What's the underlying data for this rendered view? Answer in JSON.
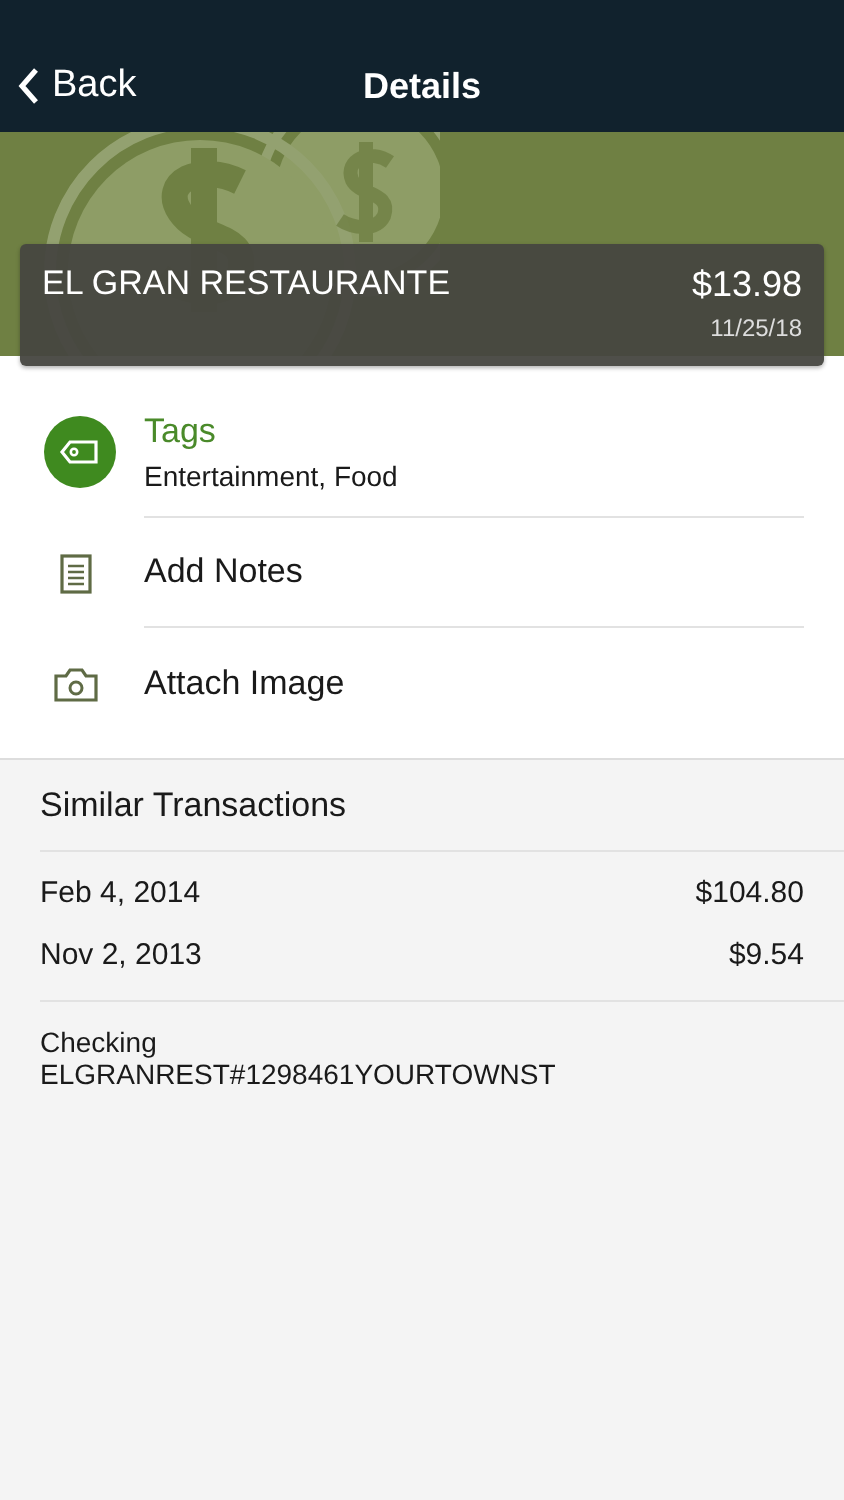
{
  "nav": {
    "back": "Back",
    "title": "Details"
  },
  "transaction": {
    "merchant": "EL GRAN RESTAURANTE",
    "amount": "$13.98",
    "date": "11/25/18"
  },
  "actions": [
    {
      "kind": "tags",
      "label": "Tags",
      "detail": "Entertainment, Food"
    },
    {
      "kind": "notes",
      "label": "Add Notes"
    },
    {
      "kind": "image",
      "label": "Attach Image"
    }
  ],
  "similar": {
    "title": "Similar Transactions",
    "rows": [
      {
        "date": "Feb 4, 2014",
        "amount": "$104.80"
      },
      {
        "date": "Nov 2, 2013",
        "amount": "$9.54"
      }
    ]
  },
  "account": {
    "name": "Checking",
    "description": "ELGRANREST#1298461YOURTOWNST"
  }
}
